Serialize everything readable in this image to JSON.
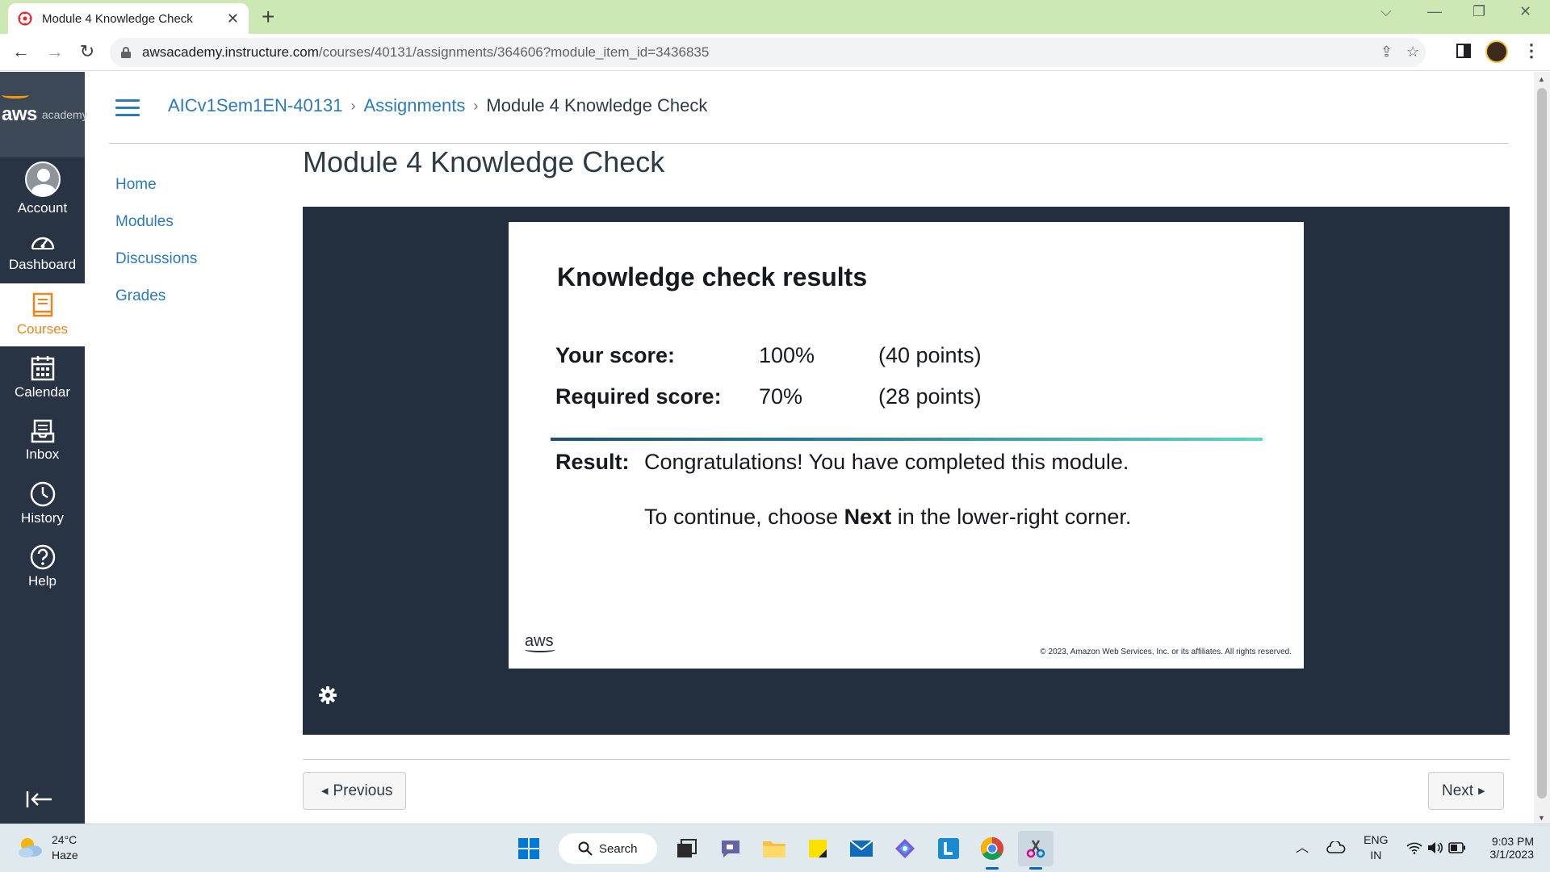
{
  "browser": {
    "tab_title": "Module 4 Knowledge Check",
    "url_host": "awsacademy.instructure.com",
    "url_path": "/courses/40131/assignments/364606?module_item_id=3436835"
  },
  "global_nav": {
    "logo_aws": "aws",
    "logo_academy": "academy",
    "items": [
      {
        "label": "Account",
        "icon": "account-avatar-icon"
      },
      {
        "label": "Dashboard",
        "icon": "dashboard-gauge-icon"
      },
      {
        "label": "Courses",
        "icon": "courses-book-icon",
        "active": true
      },
      {
        "label": "Calendar",
        "icon": "calendar-icon"
      },
      {
        "label": "Inbox",
        "icon": "inbox-icon"
      },
      {
        "label": "History",
        "icon": "clock-icon"
      },
      {
        "label": "Help",
        "icon": "help-question-icon"
      }
    ]
  },
  "breadcrumb": {
    "course": "AICv1Sem1EN-40131",
    "section": "Assignments",
    "current": "Module 4 Knowledge Check",
    "separator": "›"
  },
  "course_nav": [
    "Home",
    "Modules",
    "Discussions",
    "Grades"
  ],
  "page": {
    "title": "Module 4 Knowledge Check"
  },
  "slide": {
    "title": "Knowledge check results",
    "your_score_label": "Your score:",
    "your_score_pct": "100%",
    "your_score_points": "(40 points)",
    "required_score_label": "Required score:",
    "required_score_pct": "70%",
    "required_score_points": "(28 points)",
    "result_label": "Result:",
    "result_text": "Congratulations! You have completed this module.",
    "continue_prefix": "To continue, choose ",
    "continue_bold": "Next",
    "continue_suffix": " in the lower-right corner.",
    "logo": "aws",
    "copyright": "© 2023, Amazon Web Services, Inc. or its affiliates. All rights reserved."
  },
  "pager": {
    "previous": "Previous",
    "next": "Next"
  },
  "taskbar": {
    "temperature": "24°C",
    "condition": "Haze",
    "search_label": "Search",
    "language_top": "ENG",
    "language_bottom": "IN",
    "time": "9:03 PM",
    "date": "3/1/2023"
  },
  "colors": {
    "canvas_nav": "#283344",
    "canvas_link": "#2b7abc",
    "courses_active": "#e7861c",
    "player_bg": "#232f3e",
    "aws_orange": "#ff9900",
    "tabbar": "#cde8b5"
  }
}
